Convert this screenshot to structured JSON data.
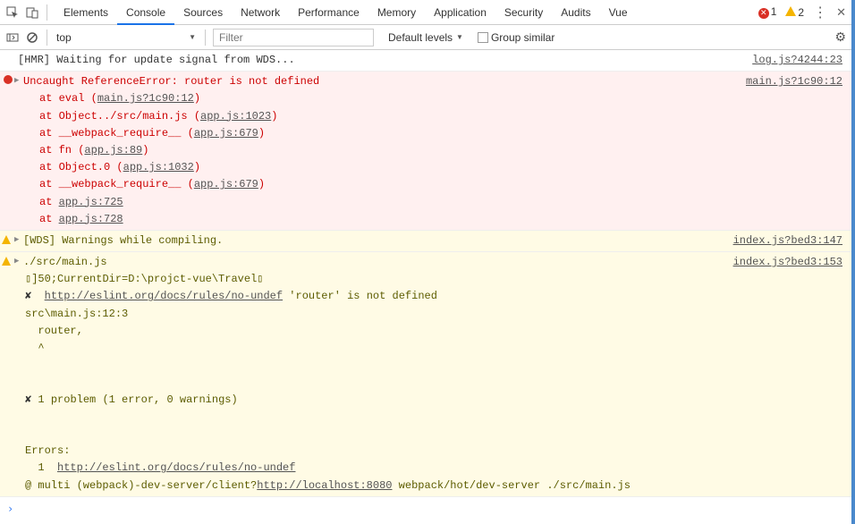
{
  "toolbar": {
    "tabs": [
      "Elements",
      "Console",
      "Sources",
      "Network",
      "Performance",
      "Memory",
      "Application",
      "Security",
      "Audits",
      "Vue"
    ],
    "active_tab": "Console",
    "error_count": "1",
    "warn_count": "2"
  },
  "filterbar": {
    "context": "top",
    "filter_placeholder": "Filter",
    "levels_label": "Default levels",
    "group_label": "Group similar"
  },
  "log0": {
    "msg": "[HMR] Waiting for update signal from WDS...",
    "src": "log.js?4244:23"
  },
  "err": {
    "head": "Uncaught ReferenceError: router is not defined",
    "src": "main.js?1c90:12",
    "s0a": "at eval (",
    "s0b": "main.js?1c90:12",
    "s0c": ")",
    "s1a": "at Object../src/main.js (",
    "s1b": "app.js:1023",
    "s1c": ")",
    "s2a": "at __webpack_require__ (",
    "s2b": "app.js:679",
    "s2c": ")",
    "s3a": "at fn (",
    "s3b": "app.js:89",
    "s3c": ")",
    "s4a": "at Object.0 (",
    "s4b": "app.js:1032",
    "s4c": ")",
    "s5a": "at __webpack_require__ (",
    "s5b": "app.js:679",
    "s5c": ")",
    "s6a": "at ",
    "s6b": "app.js:725",
    "s7a": "at ",
    "s7b": "app.js:728"
  },
  "warn1": {
    "msg": "[WDS] Warnings while compiling.",
    "src": "index.js?bed3:147"
  },
  "warn2": {
    "msg": "./src/main.js",
    "src": "index.js?bed3:153",
    "line2": "▯]50;CurrentDir=D:\\projct-vue\\Travel▯",
    "cross1": "✘",
    "link": "http://eslint.org/docs/rules/no-undef",
    "after_link": "  'router' is not defined",
    "loc": "src\\main.js:12:3",
    "code": "  router,",
    "caret": "  ^",
    "cross2": "✘",
    "summary_after": " 1 problem (1 error, 0 warnings)",
    "errhead": "Errors:",
    "err1a": "  1  ",
    "err1link": "http://eslint.org/docs/rules/no-undef",
    "multi_a": " @ multi (webpack)-dev-server/client?",
    "multi_link": "http://localhost:8080",
    "multi_b": " webpack/hot/dev-server ./src/main.js"
  },
  "prompt": "›"
}
